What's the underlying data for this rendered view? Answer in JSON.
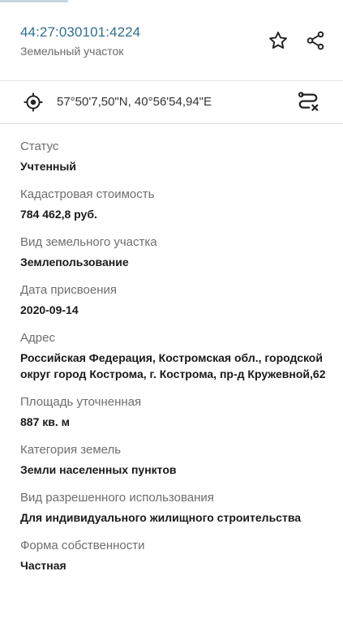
{
  "header": {
    "cadastral_number": "44:27:030101:4224",
    "object_type": "Земельный участок",
    "icons": [
      "star-icon",
      "share-icon"
    ]
  },
  "coordinates": {
    "text": "57°50'7,50\"N, 40°56'54,94\"E",
    "icons": [
      "target-icon",
      "route-icon"
    ]
  },
  "fields": [
    {
      "label": "Статус",
      "value": "Учтенный"
    },
    {
      "label": "Кадастровая стоимость",
      "value": "784 462,8 руб."
    },
    {
      "label": "Вид земельного участка",
      "value": "Землепользование"
    },
    {
      "label": "Дата присвоения",
      "value": "2020-09-14"
    },
    {
      "label": "Адрес",
      "value": "Российская Федерация, Костромская обл., городской округ город Кострома, г. Кострома, пр-д Кружевной,62"
    },
    {
      "label": "Площадь уточненная",
      "value": "887 кв. м"
    },
    {
      "label": "Категория земель",
      "value": "Земли населенных пунктов"
    },
    {
      "label": "Вид разрешенного использования",
      "value": "Для индивидуального жилищного строительства"
    },
    {
      "label": "Форма собственности",
      "value": "Частная"
    }
  ],
  "colors": {
    "accent": "#2f6f8f",
    "label": "#6e6e6e",
    "value": "#1a1a1a"
  }
}
